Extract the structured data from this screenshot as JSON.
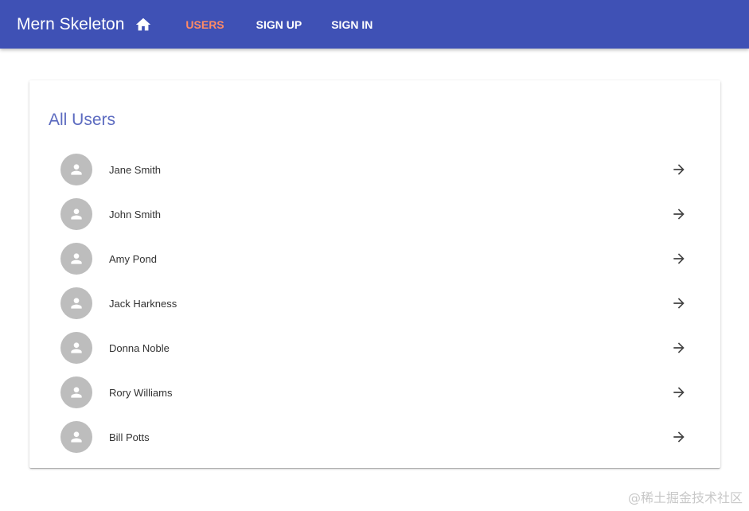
{
  "appbar": {
    "title": "Mern Skeleton",
    "home_icon": "home-icon",
    "nav": [
      {
        "label": "USERS",
        "active": true
      },
      {
        "label": "SIGN UP",
        "active": false
      },
      {
        "label": "SIGN IN",
        "active": false
      }
    ],
    "color": "#3f51b5",
    "active_color": "#ff8a65"
  },
  "card": {
    "title": "All Users",
    "title_color": "#5c6bc0"
  },
  "users": [
    {
      "name": "Jane Smith",
      "avatar_icon": "person-icon",
      "action_icon": "arrow-forward-icon"
    },
    {
      "name": "John Smith",
      "avatar_icon": "person-icon",
      "action_icon": "arrow-forward-icon"
    },
    {
      "name": "Amy Pond",
      "avatar_icon": "person-icon",
      "action_icon": "arrow-forward-icon"
    },
    {
      "name": "Jack Harkness",
      "avatar_icon": "person-icon",
      "action_icon": "arrow-forward-icon"
    },
    {
      "name": "Donna Noble",
      "avatar_icon": "person-icon",
      "action_icon": "arrow-forward-icon"
    },
    {
      "name": "Rory Williams",
      "avatar_icon": "person-icon",
      "action_icon": "arrow-forward-icon"
    },
    {
      "name": "Bill Potts",
      "avatar_icon": "person-icon",
      "action_icon": "arrow-forward-icon"
    }
  ],
  "watermark": "@稀土掘金技术社区"
}
